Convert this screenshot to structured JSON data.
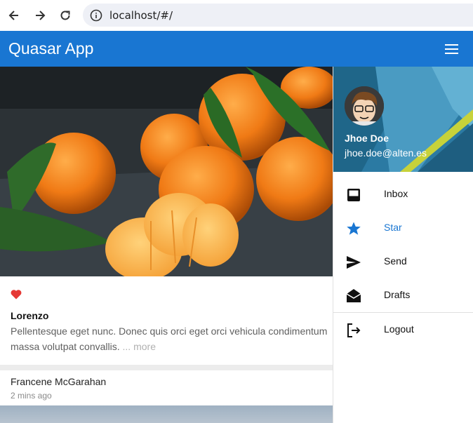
{
  "browser": {
    "url": "localhost/#/",
    "icons": [
      "back-arrow-icon",
      "forward-arrow-icon",
      "reload-icon",
      "info-icon"
    ]
  },
  "app": {
    "title": "Quasar App",
    "brand_color": "#1976d2"
  },
  "card": {
    "author": "Lorenzo",
    "text": "Pellentesque eget nunc. Donec quis orci eget orci vehicula condimentum",
    "text2": "massa volutpat convallis.",
    "more": "... more",
    "heart_color": "#e53935"
  },
  "post2": {
    "name": "Francene McGarahan",
    "time": "2 mins ago"
  },
  "drawer": {
    "user_name": "Jhoe Doe",
    "user_email": "jhoe.doe@alten.es",
    "items": [
      {
        "label": "Inbox",
        "icon": "inbox-icon"
      },
      {
        "label": "Star",
        "icon": "star-icon",
        "active": true
      },
      {
        "label": "Send",
        "icon": "send-icon"
      },
      {
        "label": "Drafts",
        "icon": "drafts-icon"
      },
      {
        "label": "Logout",
        "icon": "logout-icon"
      }
    ]
  }
}
